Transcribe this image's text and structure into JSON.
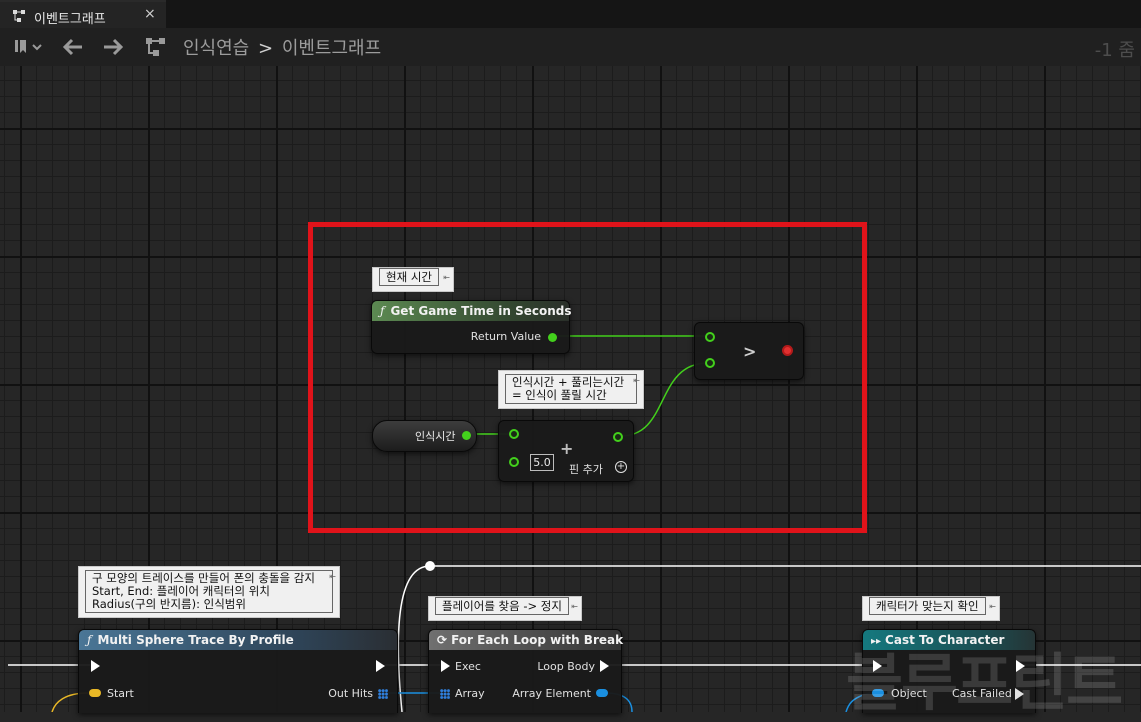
{
  "tab": {
    "label": "이벤트그래프",
    "close": "×"
  },
  "breadcrumb": {
    "root": "인식연습",
    "separator": ">",
    "current": "이벤트그래프"
  },
  "zoom": "-1 줌",
  "comments": {
    "current_time": "현재 시간",
    "recognize_plus": [
      "인식시간 + 풀리는시간",
      "= 인식이 풀릴 시간"
    ],
    "sphere": [
      "구 모양의 트레이스를 만들어 폰의 충돌을 감지",
      "Start, End: 플레이어 캐릭터의 위치",
      "Radius(구의 반지름): 인식범위"
    ],
    "found_player": "플레이어를 찾음 -> 정지",
    "check_character": "캐릭터가 맞는지 확인"
  },
  "nodes": {
    "get_game_time": {
      "title": "Get Game Time in Seconds",
      "return_value": "Return Value"
    },
    "compare": {
      "symbol": ">"
    },
    "variable": {
      "label": "인식시간"
    },
    "add": {
      "symbol": "+",
      "value": "5.0",
      "add_pin": "핀 추가"
    },
    "multi_sphere": {
      "title": "Multi Sphere Trace By Profile",
      "start": "Start",
      "out_hits": "Out Hits"
    },
    "for_each": {
      "title": "For Each Loop with Break",
      "exec": "Exec",
      "loop_body": "Loop Body",
      "array": "Array",
      "array_element": "Array Element"
    },
    "cast": {
      "title": "Cast To Character",
      "object": "Object",
      "cast_failed": "Cast Failed"
    }
  },
  "watermark": "블루프린트",
  "colors": {
    "highlight": "#e0131a",
    "float_pin": "#43d01c",
    "exec_pin": "#ffffff",
    "object_pin": "#1a8fe0"
  }
}
